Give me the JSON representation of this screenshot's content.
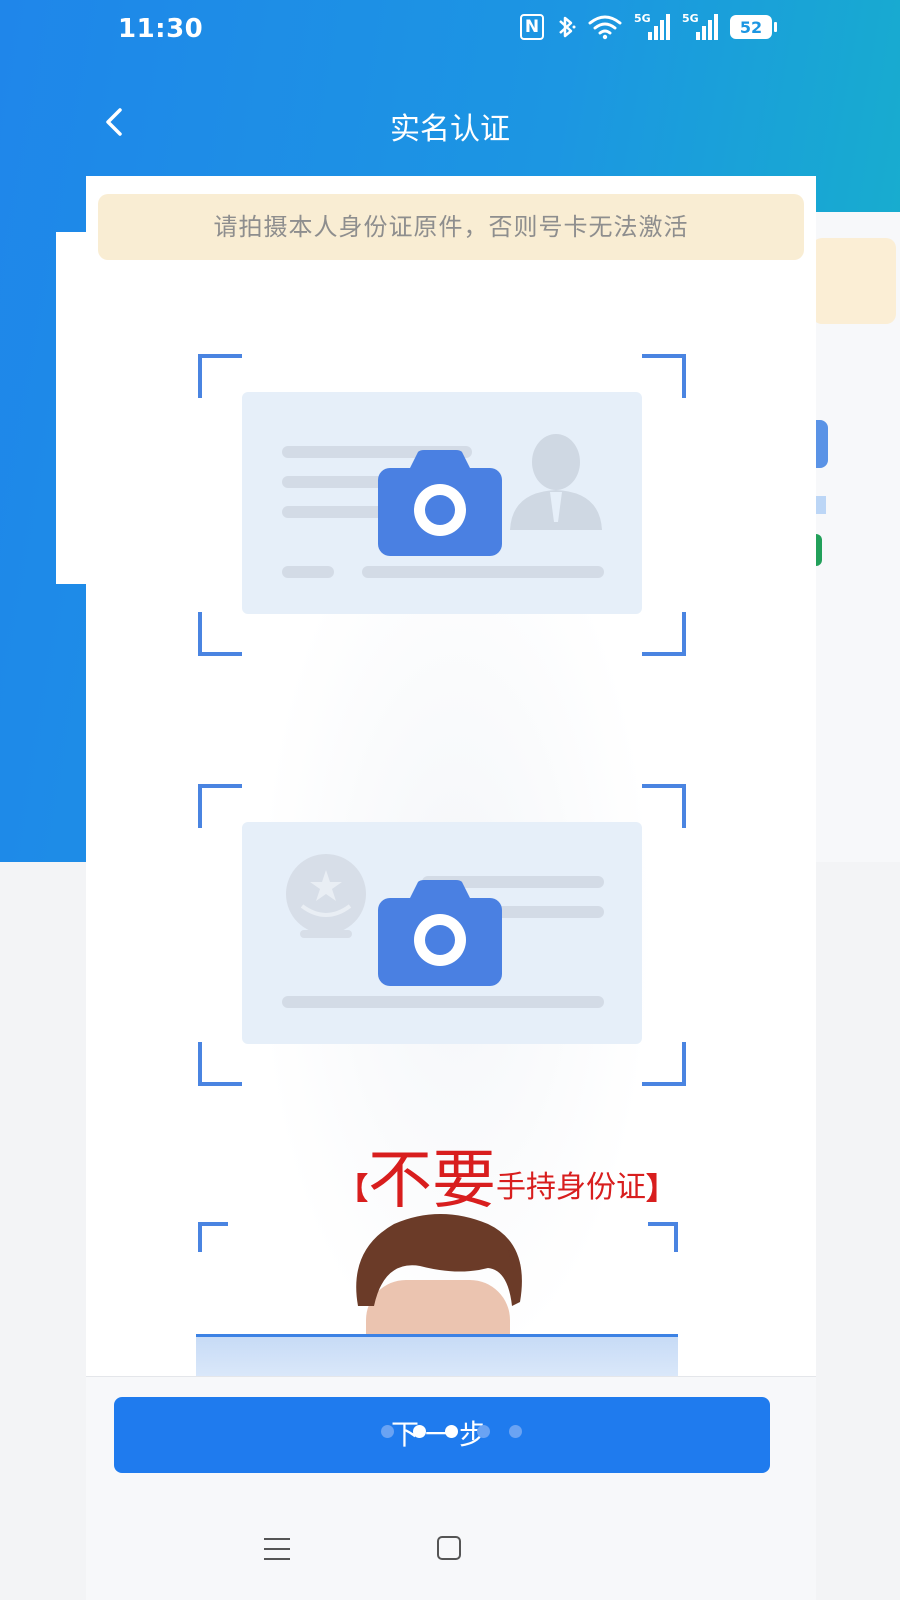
{
  "status_bar": {
    "time": "11:30",
    "nfc_label": "N",
    "signal_label_1": "5G",
    "signal_label_2": "5G",
    "battery": "52"
  },
  "header": {
    "title": "实名认证"
  },
  "notice": {
    "text": "请拍摄本人身份证原件，否则号卡无法激活"
  },
  "warning": {
    "bracket_left": "【",
    "emphasis": "不要",
    "text": "手持身份证",
    "bracket_right": "】"
  },
  "next_button": {
    "label": "下一步"
  },
  "colors": {
    "header_gradient_start": "#1f86ea",
    "header_gradient_end": "#16b3c9",
    "accent_blue": "#1f7bee",
    "frame_blue": "#4a84e1",
    "warning_red": "#d81e1e",
    "notice_bg": "#f9edd3"
  },
  "icons": [
    "chevron-left-icon",
    "nfc-icon",
    "bluetooth-icon",
    "wifi-icon",
    "signal-icon",
    "battery-icon",
    "camera-icon",
    "menu-icon",
    "home-icon"
  ]
}
